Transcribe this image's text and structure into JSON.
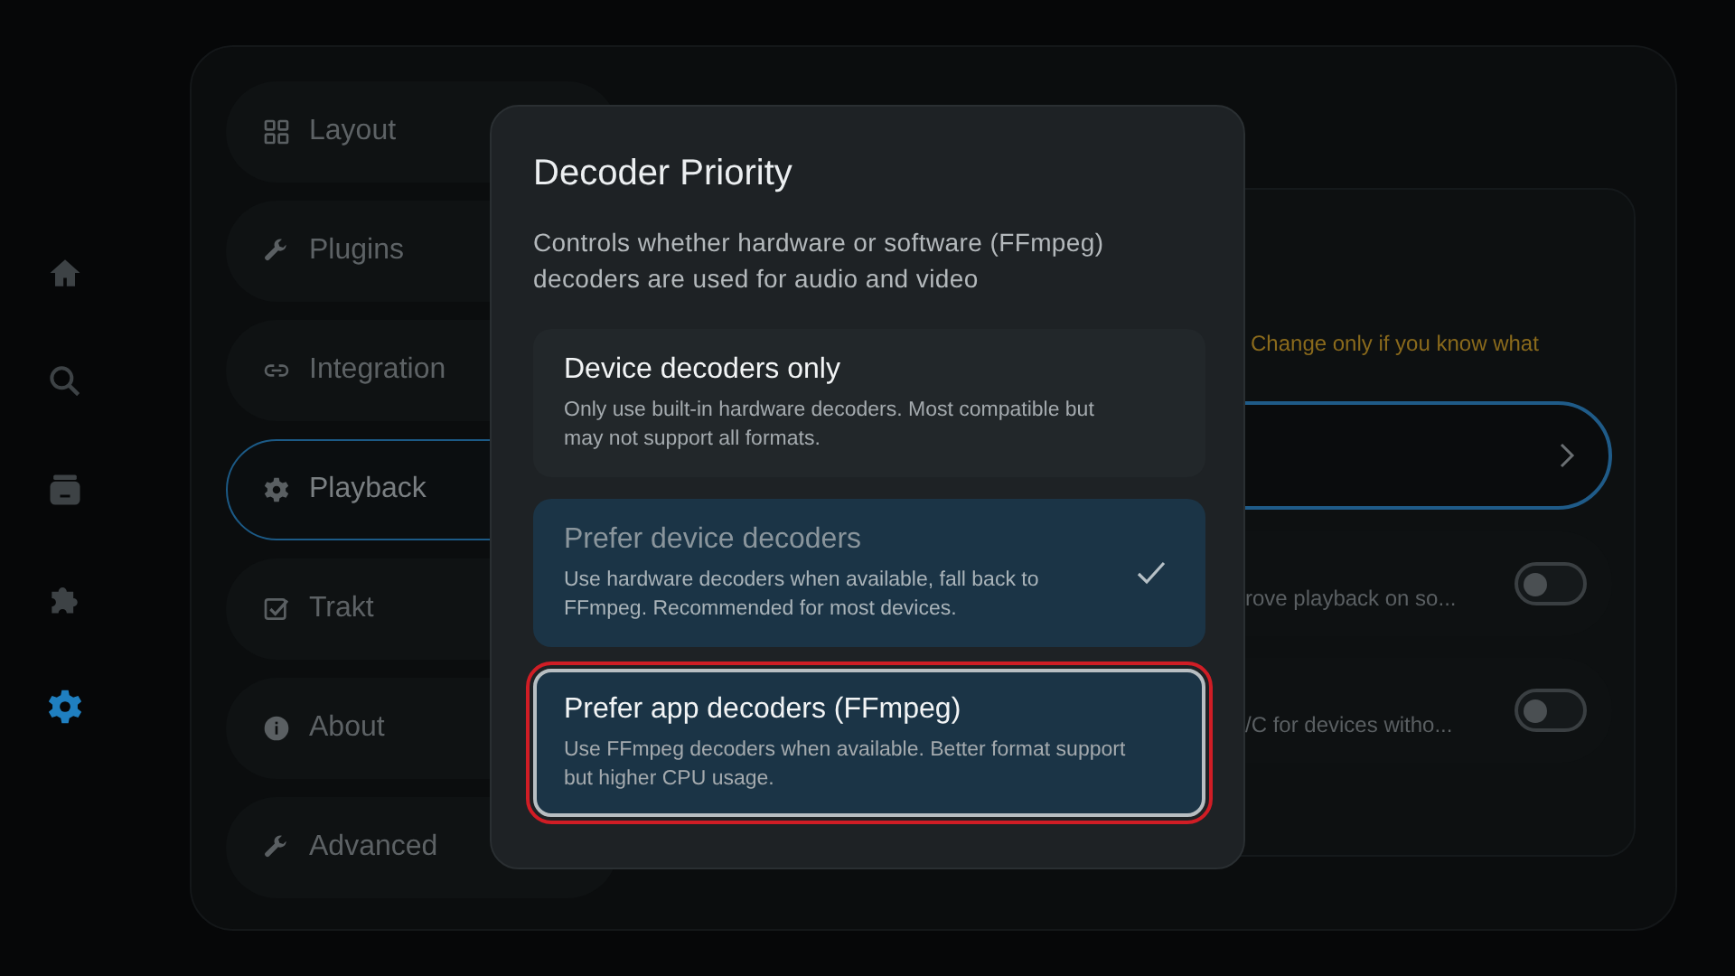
{
  "nav_rail": [
    {
      "selected": false
    },
    {
      "selected": false
    },
    {
      "selected": false
    },
    {
      "selected": false
    },
    {
      "selected": true
    }
  ],
  "settings_menu": [
    {
      "label": "Layout",
      "selected": false
    },
    {
      "label": "Plugins",
      "selected": false
    },
    {
      "label": "Integration",
      "selected": false
    },
    {
      "label": "Playback",
      "selected": true
    },
    {
      "label": "Trakt",
      "selected": false
    },
    {
      "label": "About",
      "selected": false
    },
    {
      "label": "Advanced",
      "selected": false
    }
  ],
  "background_panel": {
    "warning": "Change only if you know what",
    "rows": [
      {
        "kind": "link",
        "focused": true
      },
      {
        "kind": "toggle",
        "description": "rove playback on so...",
        "on": false
      },
      {
        "kind": "toggle",
        "description": "/C for devices witho...",
        "on": false
      }
    ]
  },
  "dialog": {
    "title": "Decoder Priority",
    "description": "Controls whether hardware or software (FFmpeg) decoders are used for audio and video",
    "options": [
      {
        "title": "Device decoders only",
        "description": "Only use built-in hardware decoders. Most compatible but may not support all formats.",
        "selected": false,
        "focused": false
      },
      {
        "title": "Prefer device decoders",
        "description": "Use hardware decoders when available, fall back to FFmpeg. Recommended for most devices.",
        "selected": true,
        "focused": false
      },
      {
        "title": "Prefer app decoders (FFmpeg)",
        "description": "Use FFmpeg decoders when available. Better format support but higher CPU usage.",
        "selected": false,
        "focused": true
      }
    ]
  }
}
